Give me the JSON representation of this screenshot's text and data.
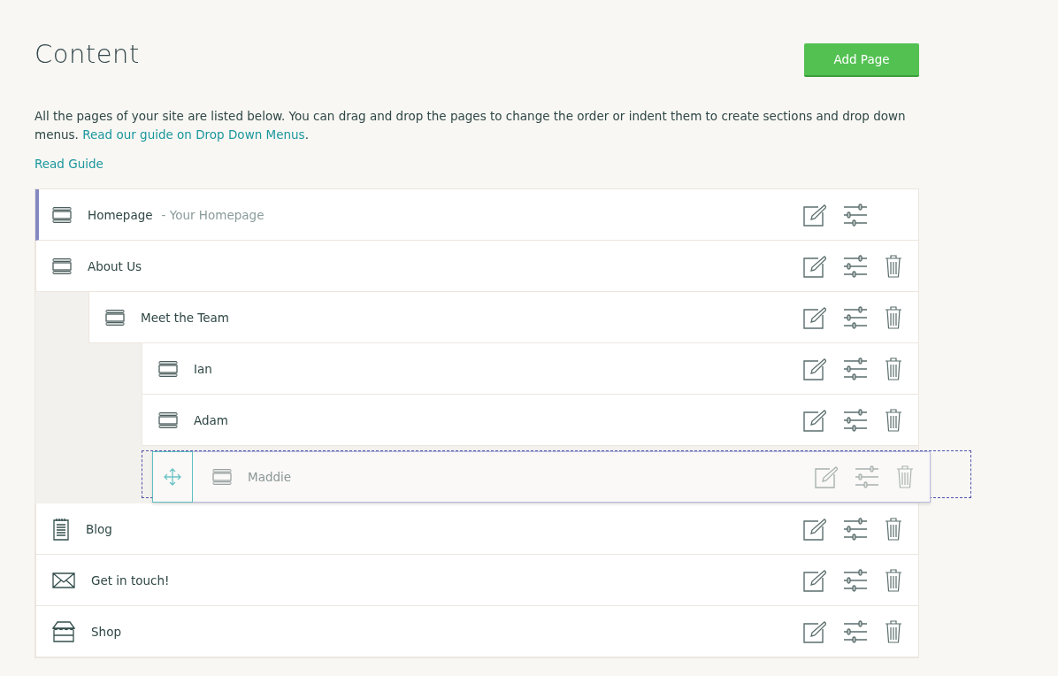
{
  "title": "Content",
  "add_button": "Add Page",
  "description_parts": [
    "All the pages of your site are listed below. You can drag and drop the pages to change the order or indent them to create sections and drop down menus. ",
    "Read our guide on Drop Down Menus",
    "."
  ],
  "read_guide": "Read Guide",
  "pages": [
    {
      "name": "Homepage",
      "note": "- Your Homepage",
      "kind": "page",
      "home": true,
      "deletable": false,
      "dragging": false
    },
    {
      "name": "About Us",
      "kind": "page",
      "home": false,
      "deletable": true,
      "dragging": false,
      "children": [
        {
          "name": "Meet the Team",
          "kind": "page",
          "home": false,
          "deletable": true,
          "dragging": false,
          "children": [
            {
              "name": "Ian",
              "kind": "page",
              "home": false,
              "deletable": true,
              "dragging": false
            },
            {
              "name": "Adam",
              "kind": "page",
              "home": false,
              "deletable": true,
              "dragging": false
            },
            {
              "name": "Maddie",
              "kind": "page",
              "home": false,
              "deletable": true,
              "dragging": true
            }
          ]
        }
      ]
    },
    {
      "name": "Blog",
      "kind": "blog",
      "home": false,
      "deletable": true,
      "dragging": false
    },
    {
      "name": "Get in touch!",
      "kind": "contact",
      "home": false,
      "deletable": true,
      "dragging": false
    },
    {
      "name": "Shop",
      "kind": "shop",
      "home": false,
      "deletable": true,
      "dragging": false
    }
  ]
}
